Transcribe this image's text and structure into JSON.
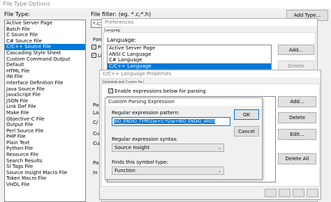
{
  "file_type_window": {
    "title": "File Type Options",
    "file_type_label": "File Type:",
    "file_types": [
      "Active Server Page",
      "Batch File",
      "C Source File",
      "C# Source File",
      "C/C++ Source File",
      "Cascading Style Sheet",
      "Custom Command Output",
      "Default",
      "HTML File",
      "INI File",
      "Interface Definition File",
      "Java Source File",
      "JavaScript File",
      "JSON File",
      "Link Def File",
      "Make File",
      "Objective-C File",
      "Output File",
      "Perl Source File",
      "PHP File",
      "Plain Text",
      "Python File",
      "Resource File",
      "Search Results",
      "SI Tags File",
      "Source Insight Macro File",
      "Token Macro File",
      "VHDL File"
    ],
    "selected_index": 4,
    "file_filter_label": "File filter: (eg. *.c;*.h)",
    "file_filter_value": "*.c;*.h",
    "add_type_button": "Add Type...",
    "partial_labels": {
      "font": "Font",
      "pr": "Pr",
      "lin": "Lin",
      "par": "Par",
      "lan": "Lan",
      "c": "C/",
      "cus": "Cus",
      "cu": "Cu",
      "par2": "Par",
      "in": "In"
    }
  },
  "preferences_window": {
    "title": "Preferences",
    "tab": "Languages",
    "language_label": "Language:",
    "languages": [
      "Active Server Page",
      "ANSI C Language",
      "C# Language",
      "C/C++ Language"
    ],
    "selected_index": 3,
    "add_button": "Add...",
    "delete_button": "Delete"
  },
  "lang_props_window": {
    "title": "C/C++ Language Properties",
    "tabs": [
      "Comments and Ranges",
      "Custom Parsing"
    ],
    "active_tab": 1,
    "enable_checkbox_label": "Enable expressions below for parsing",
    "enable_checked": true,
    "add_button": "Add...",
    "delete_button": "Delete",
    "edit_button": "Edit...",
    "delete_all_button": "Delete All",
    "bottom_buttons": [
      "",
      "",
      "",
      ""
    ]
  },
  "custom_parsing_dialog": {
    "title": "Custom Parsing Expression",
    "pattern_label": "Regular expression pattern:",
    "pattern_value": "BIO_ENDIO_TYPE\\(\\w+\\(.*\\)\\w+BIO_ENDIO_ARGS",
    "syntax_label": "Regular expression syntax:",
    "syntax_value": "Source Insight",
    "symbol_type_label": "Finds this symbol type:",
    "symbol_type_value": "Function",
    "ok_button": "OK",
    "cancel_button": "Cancel"
  }
}
